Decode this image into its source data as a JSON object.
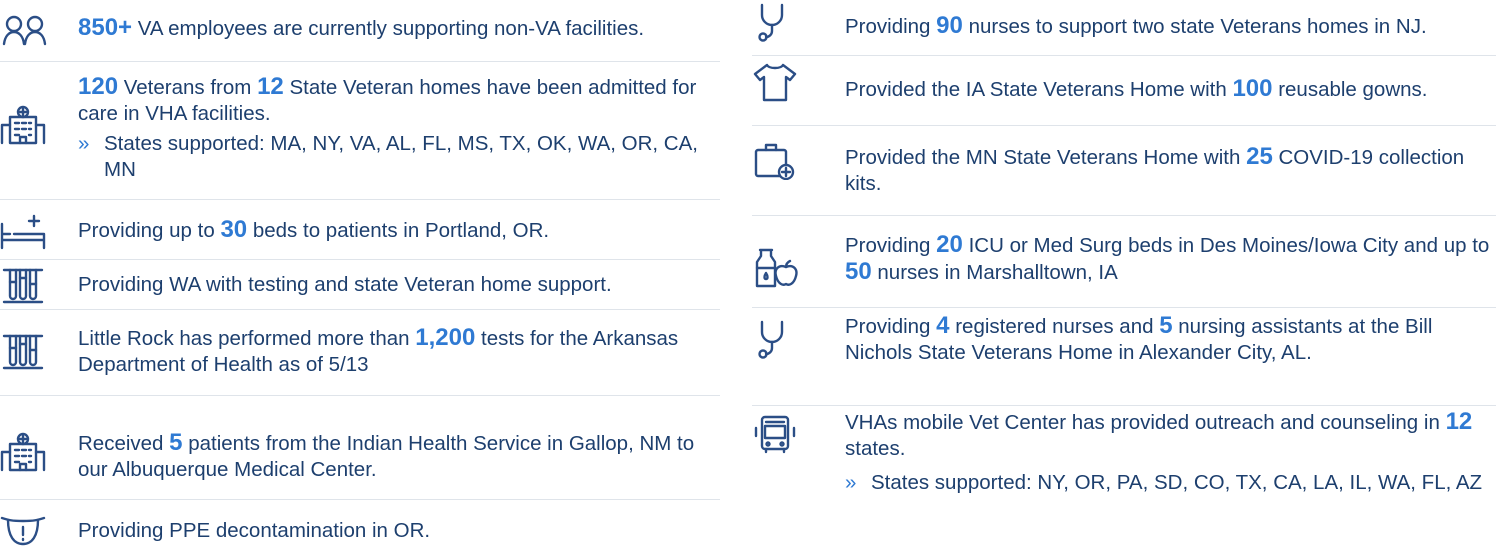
{
  "left": {
    "employees": {
      "num": "850+",
      "text": " VA employees are currently supporting non-VA facilities.",
      "icon": "people-icon"
    },
    "veterans": {
      "num1": "120",
      "t1": " Veterans from ",
      "num2": "12",
      "t2": " State Veteran homes have been admitted for care in VHA facilities.",
      "bullet": "»",
      "sub": "States supported: MA, NY, VA, AL, FL, MS, TX, OK, WA, OR, CA, MN",
      "icon": "hospital-icon"
    },
    "beds": {
      "t1": "Providing up to ",
      "num": "30",
      "t2": " beds to patients in Portland, OR.",
      "icon": "hospital-bed-icon"
    },
    "testing": {
      "text": "Providing WA with testing and state Veteran home support.",
      "icon": "test-tubes-icon"
    },
    "littlerock": {
      "t1": "Little Rock has performed more than ",
      "num": "1,200",
      "t2": " tests for the Arkansas Department of Health as of 5/13",
      "icon": "test-tubes-icon"
    },
    "received": {
      "t1": "Received ",
      "num": "5",
      "t2": " patients from the Indian Health Service in Gallop, NM to our Albuquerque Medical Center.",
      "icon": "hospital-icon"
    },
    "ppe": {
      "text": "Providing PPE decontamination in OR.",
      "icon": "face-mask-icon"
    }
  },
  "right": {
    "nurses_nj": {
      "t1": "Providing ",
      "num": "90",
      "t2": " nurses to support two state Veterans homes in NJ.",
      "icon": "stethoscope-icon"
    },
    "gowns": {
      "t1": "Provided the IA State Veterans Home with ",
      "num": "100",
      "t2": " reusable gowns.",
      "icon": "gown-icon"
    },
    "kits": {
      "t1": "Provided the MN State Veterans Home with ",
      "num": "25",
      "t2": " COVID-19 collection kits.",
      "icon": "medical-kit-icon"
    },
    "icu": {
      "t1": "Providing ",
      "num1": "20",
      "t2": " ICU or Med Surg beds in Des Moines/Iowa City and up to ",
      "num2": "50",
      "t3": " nurses in Marshalltown, IA",
      "icon": "food-supplies-icon"
    },
    "al": {
      "t1": "Providing ",
      "num1": "4",
      "t2": " registered nurses and ",
      "num2": "5",
      "t3": " nursing assistants at the Bill Nichols State Veterans Home in Alexander City, AL.",
      "icon": "stethoscope-icon"
    },
    "mobile": {
      "t1": "VHAs mobile Vet Center has provided outreach and counseling in ",
      "num": "12",
      "t2": " states.",
      "bullet": "»",
      "sub": "States supported: NY, OR, PA, SD, CO, TX, CA, LA, IL, WA, FL, AZ",
      "icon": "bus-icon"
    }
  },
  "colors": {
    "text": "#1d3f6e",
    "accent": "#2f7ad3",
    "icon": "#2b4e86",
    "divider": "#dfe4ea"
  }
}
